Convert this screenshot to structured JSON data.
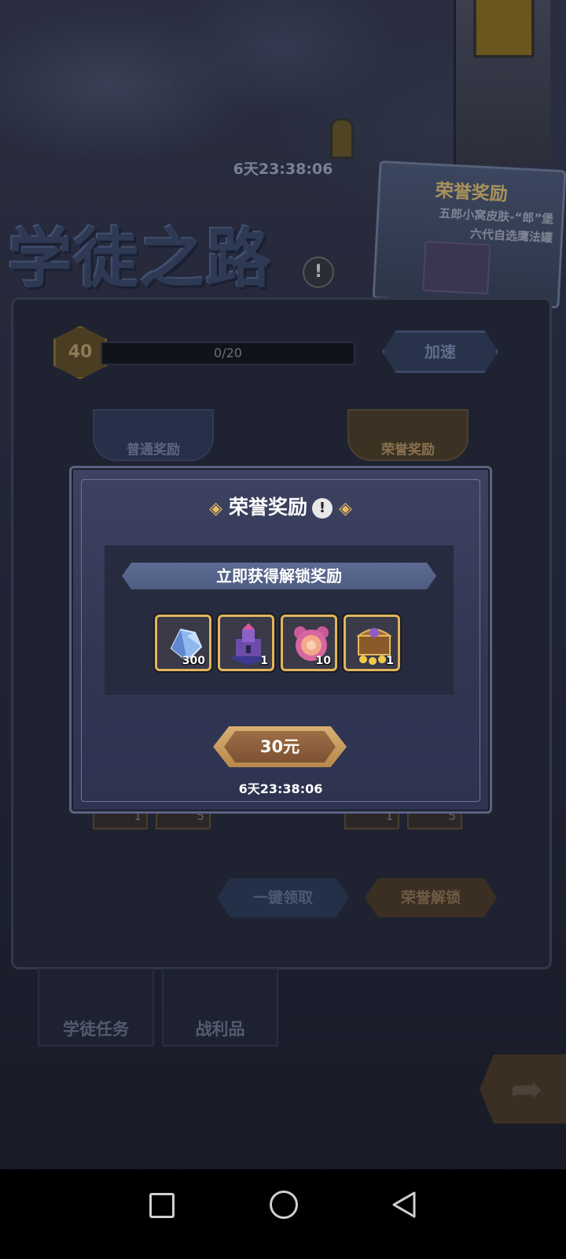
{
  "background": {
    "top_timer": "6天23:38:06",
    "title_logo": "学徒之路",
    "info_icon": "!",
    "honor_banner": {
      "title": "荣誉奖励",
      "line1": "五郎小窝皮肤-“郎”堡",
      "line2": "六代自选鹰法罐"
    },
    "level": "40",
    "progress_text": "0/20",
    "speed_button": "加速",
    "tab_normal": "普通奖励",
    "tab_honor": "荣誉奖励",
    "faded_counts": [
      "1",
      "5",
      "1",
      "5"
    ],
    "claim_all_button": "一键领取",
    "honor_unlock_button": "荣誉解锁",
    "nav_tasks": "学徒任务",
    "nav_loot": "战利品",
    "share_icon": "share-arrow-icon"
  },
  "modal": {
    "title": "荣誉奖励",
    "title_info": "!",
    "ribbon": "立即获得解锁奖励",
    "items": [
      {
        "icon": "crystal-icon",
        "count": "300"
      },
      {
        "icon": "castle-icon",
        "count": "1"
      },
      {
        "icon": "pet-badge-icon",
        "count": "10"
      },
      {
        "icon": "treasure-chest-icon",
        "count": "1"
      }
    ],
    "price": "30元",
    "timer": "6天23:38:06"
  },
  "colors": {
    "accent_gold": "#e0b55c",
    "modal_bg": "#363c5a",
    "price_button": "#9d6d45"
  }
}
